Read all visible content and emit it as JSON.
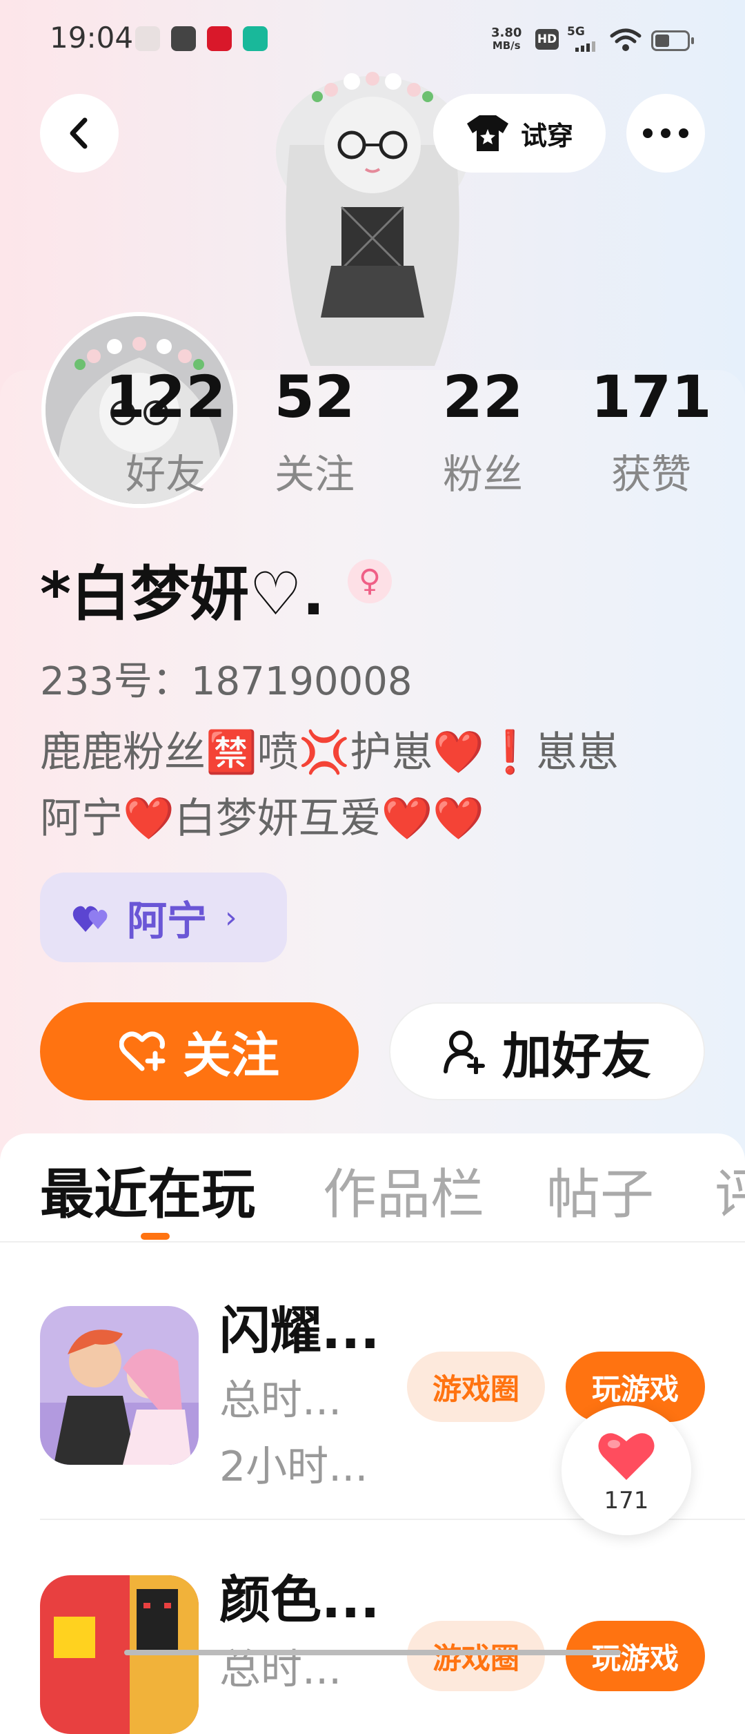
{
  "status_bar": {
    "time": "19:04",
    "net_speed_value": "3.80",
    "net_speed_unit": "MB/s",
    "hd": "HD",
    "signal": "5G"
  },
  "header": {
    "tryon_label": "试穿"
  },
  "stats": [
    {
      "value": "122",
      "label": "好友"
    },
    {
      "value": "52",
      "label": "关注"
    },
    {
      "value": "22",
      "label": "粉丝"
    },
    {
      "value": "171",
      "label": "获赞"
    }
  ],
  "profile": {
    "name": "*白梦妍♡.",
    "gender_symbol": "♀",
    "uid": "233号：187190008",
    "bio_line1": "鹿鹿粉丝🈲喷💢护崽❤️❗崽崽",
    "bio_line2": "阿宁❤️白梦妍互爱❤️❤️",
    "badge_label": "阿宁"
  },
  "actions": {
    "follow_label": "关注",
    "add_friend_label": "加好友"
  },
  "tabs": [
    {
      "label": "最近在玩"
    },
    {
      "label": "作品栏"
    },
    {
      "label": "帖子"
    },
    {
      "label": "评"
    }
  ],
  "games": [
    {
      "title": "闪耀...",
      "total_time_label": "总时...",
      "time": "2小时...",
      "circle_label": "游戏圈",
      "play_label": "玩游戏"
    },
    {
      "title": "颜色...",
      "total_time_label": "总时...",
      "circle_label": "游戏圈",
      "play_label": "玩游戏"
    }
  ],
  "like_fab": {
    "count": "171"
  },
  "colors": {
    "accent": "#ff7311",
    "badge": "#6a56d6",
    "like": "#ff4d5e"
  }
}
